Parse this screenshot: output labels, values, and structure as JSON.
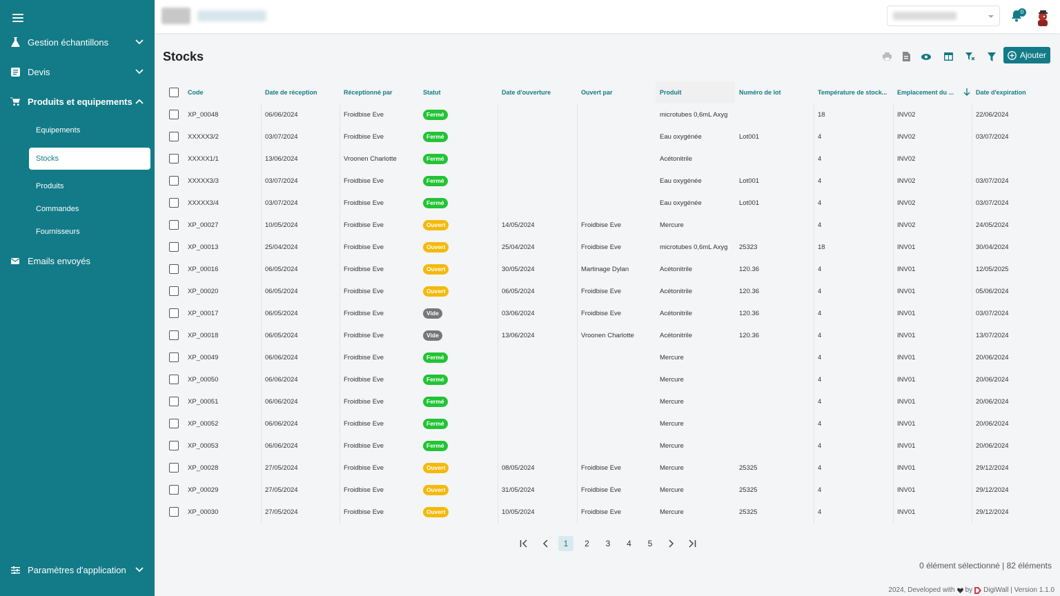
{
  "sidebar": {
    "groups": [
      {
        "label": "Gestion échantillons",
        "icon": "flask-icon"
      },
      {
        "label": "Devis",
        "icon": "document-icon"
      },
      {
        "label": "Produits et equipements",
        "icon": "cart-icon"
      },
      {
        "label": "Emails envoyés",
        "icon": "mail-icon"
      },
      {
        "label": "Paramètres d'application",
        "icon": "sliders-icon"
      }
    ],
    "sub_items": [
      "Equipements",
      "Stocks",
      "Produits",
      "Commandes",
      "Fournisseurs"
    ],
    "active_item": "Stocks"
  },
  "topbar": {
    "notification_count": "0"
  },
  "page": {
    "title": "Stocks",
    "add_label": "Ajouter"
  },
  "table": {
    "headers": [
      "Code",
      "Date de réception",
      "Réceptionné par",
      "Statut",
      "Date d'ouverture",
      "Ouvert par",
      "Produit",
      "Numéro de lot",
      "Température de stock...",
      "Emplacement du ...",
      "Date d'expiration"
    ],
    "rows": [
      [
        "XP_00048",
        "06/06/2024",
        "Froidbise Eve",
        "Fermé",
        "",
        "",
        "microtubes 0,6mL Axyg",
        "",
        "18",
        "INV02",
        "22/06/2024"
      ],
      [
        "XXXXX3/2",
        "03/07/2024",
        "Froidbise Eve",
        "Fermé",
        "",
        "",
        "Eau oxygénée",
        "Lot001",
        "4",
        "INV02",
        "03/07/2024"
      ],
      [
        "XXXXX1/1",
        "13/06/2024",
        "Vroonen Charlotte",
        "Fermé",
        "",
        "",
        "Acétonitrile",
        "",
        "4",
        "INV02",
        ""
      ],
      [
        "XXXXX3/3",
        "03/07/2024",
        "Froidbise Eve",
        "Fermé",
        "",
        "",
        "Eau oxygénée",
        "Lot001",
        "4",
        "INV02",
        "03/07/2024"
      ],
      [
        "XXXXX3/4",
        "03/07/2024",
        "Froidbise Eve",
        "Fermé",
        "",
        "",
        "Eau oxygénée",
        "Lot001",
        "4",
        "INV02",
        "03/07/2024"
      ],
      [
        "XP_00027",
        "10/05/2024",
        "Froidbise Eve",
        "Ouvert",
        "14/05/2024",
        "Froidbise Eve",
        "Mercure",
        "",
        "4",
        "INV02",
        "24/05/2024"
      ],
      [
        "XP_00013",
        "25/04/2024",
        "Froidbise Eve",
        "Ouvert",
        "25/04/2024",
        "Froidbise Eve",
        "microtubes 0,6mL Axyg",
        "25323",
        "18",
        "INV01",
        "30/04/2024"
      ],
      [
        "XP_00016",
        "06/05/2024",
        "Froidbise Eve",
        "Ouvert",
        "30/05/2024",
        "Martinage Dylan",
        "Acétonitrile",
        "120.36",
        "4",
        "INV01",
        "12/05/2025"
      ],
      [
        "XP_00020",
        "06/05/2024",
        "Froidbise Eve",
        "Ouvert",
        "06/05/2024",
        "Froidbise Eve",
        "Acétonitrile",
        "120.36",
        "4",
        "INV01",
        "05/06/2024"
      ],
      [
        "XP_00017",
        "06/05/2024",
        "Froidbise Eve",
        "Vide",
        "03/06/2024",
        "Froidbise Eve",
        "Acétonitrile",
        "120.36",
        "4",
        "INV01",
        "03/07/2024"
      ],
      [
        "XP_00018",
        "06/05/2024",
        "Froidbise Eve",
        "Vide",
        "13/06/2024",
        "Vroonen Charlotte",
        "Acétonitrile",
        "120.36",
        "4",
        "INV01",
        "13/07/2024"
      ],
      [
        "XP_00049",
        "06/06/2024",
        "Froidbise Eve",
        "Fermé",
        "",
        "",
        "Mercure",
        "",
        "4",
        "INV01",
        "20/06/2024"
      ],
      [
        "XP_00050",
        "06/06/2024",
        "Froidbise Eve",
        "Fermé",
        "",
        "",
        "Mercure",
        "",
        "4",
        "INV01",
        "20/06/2024"
      ],
      [
        "XP_00051",
        "06/06/2024",
        "Froidbise Eve",
        "Fermé",
        "",
        "",
        "Mercure",
        "",
        "4",
        "INV01",
        "20/06/2024"
      ],
      [
        "XP_00052",
        "06/06/2024",
        "Froidbise Eve",
        "Fermé",
        "",
        "",
        "Mercure",
        "",
        "4",
        "INV01",
        "20/06/2024"
      ],
      [
        "XP_00053",
        "06/06/2024",
        "Froidbise Eve",
        "Fermé",
        "",
        "",
        "Mercure",
        "",
        "4",
        "INV01",
        "20/06/2024"
      ],
      [
        "XP_00028",
        "27/05/2024",
        "Froidbise Eve",
        "Ouvert",
        "08/05/2024",
        "Froidbise Eve",
        "Mercure",
        "25325",
        "4",
        "INV01",
        "29/12/2024"
      ],
      [
        "XP_00029",
        "27/05/2024",
        "Froidbise Eve",
        "Ouvert",
        "31/05/2024",
        "Froidbise Eve",
        "Mercure",
        "25325",
        "4",
        "INV01",
        "29/12/2024"
      ],
      [
        "XP_00030",
        "27/05/2024",
        "Froidbise Eve",
        "Ouvert",
        "10/05/2024",
        "Froidbise Eve",
        "Mercure",
        "25325",
        "4",
        "INV01",
        "29/12/2024"
      ]
    ],
    "sorted_column": "Emplacement du ..."
  },
  "pagination": {
    "pages": [
      "1",
      "2",
      "3",
      "4",
      "5"
    ],
    "current": "1"
  },
  "selection_info": "0 élément sélectionné | 82 éléments",
  "footer": {
    "left": "2024, Developed with",
    "by": "by",
    "right": "DigiWall | Version 1.1.0"
  },
  "colors": {
    "primary": "#127b87",
    "ferme": "#22c335",
    "ouvert": "#f4b90a",
    "vide": "#777777"
  }
}
